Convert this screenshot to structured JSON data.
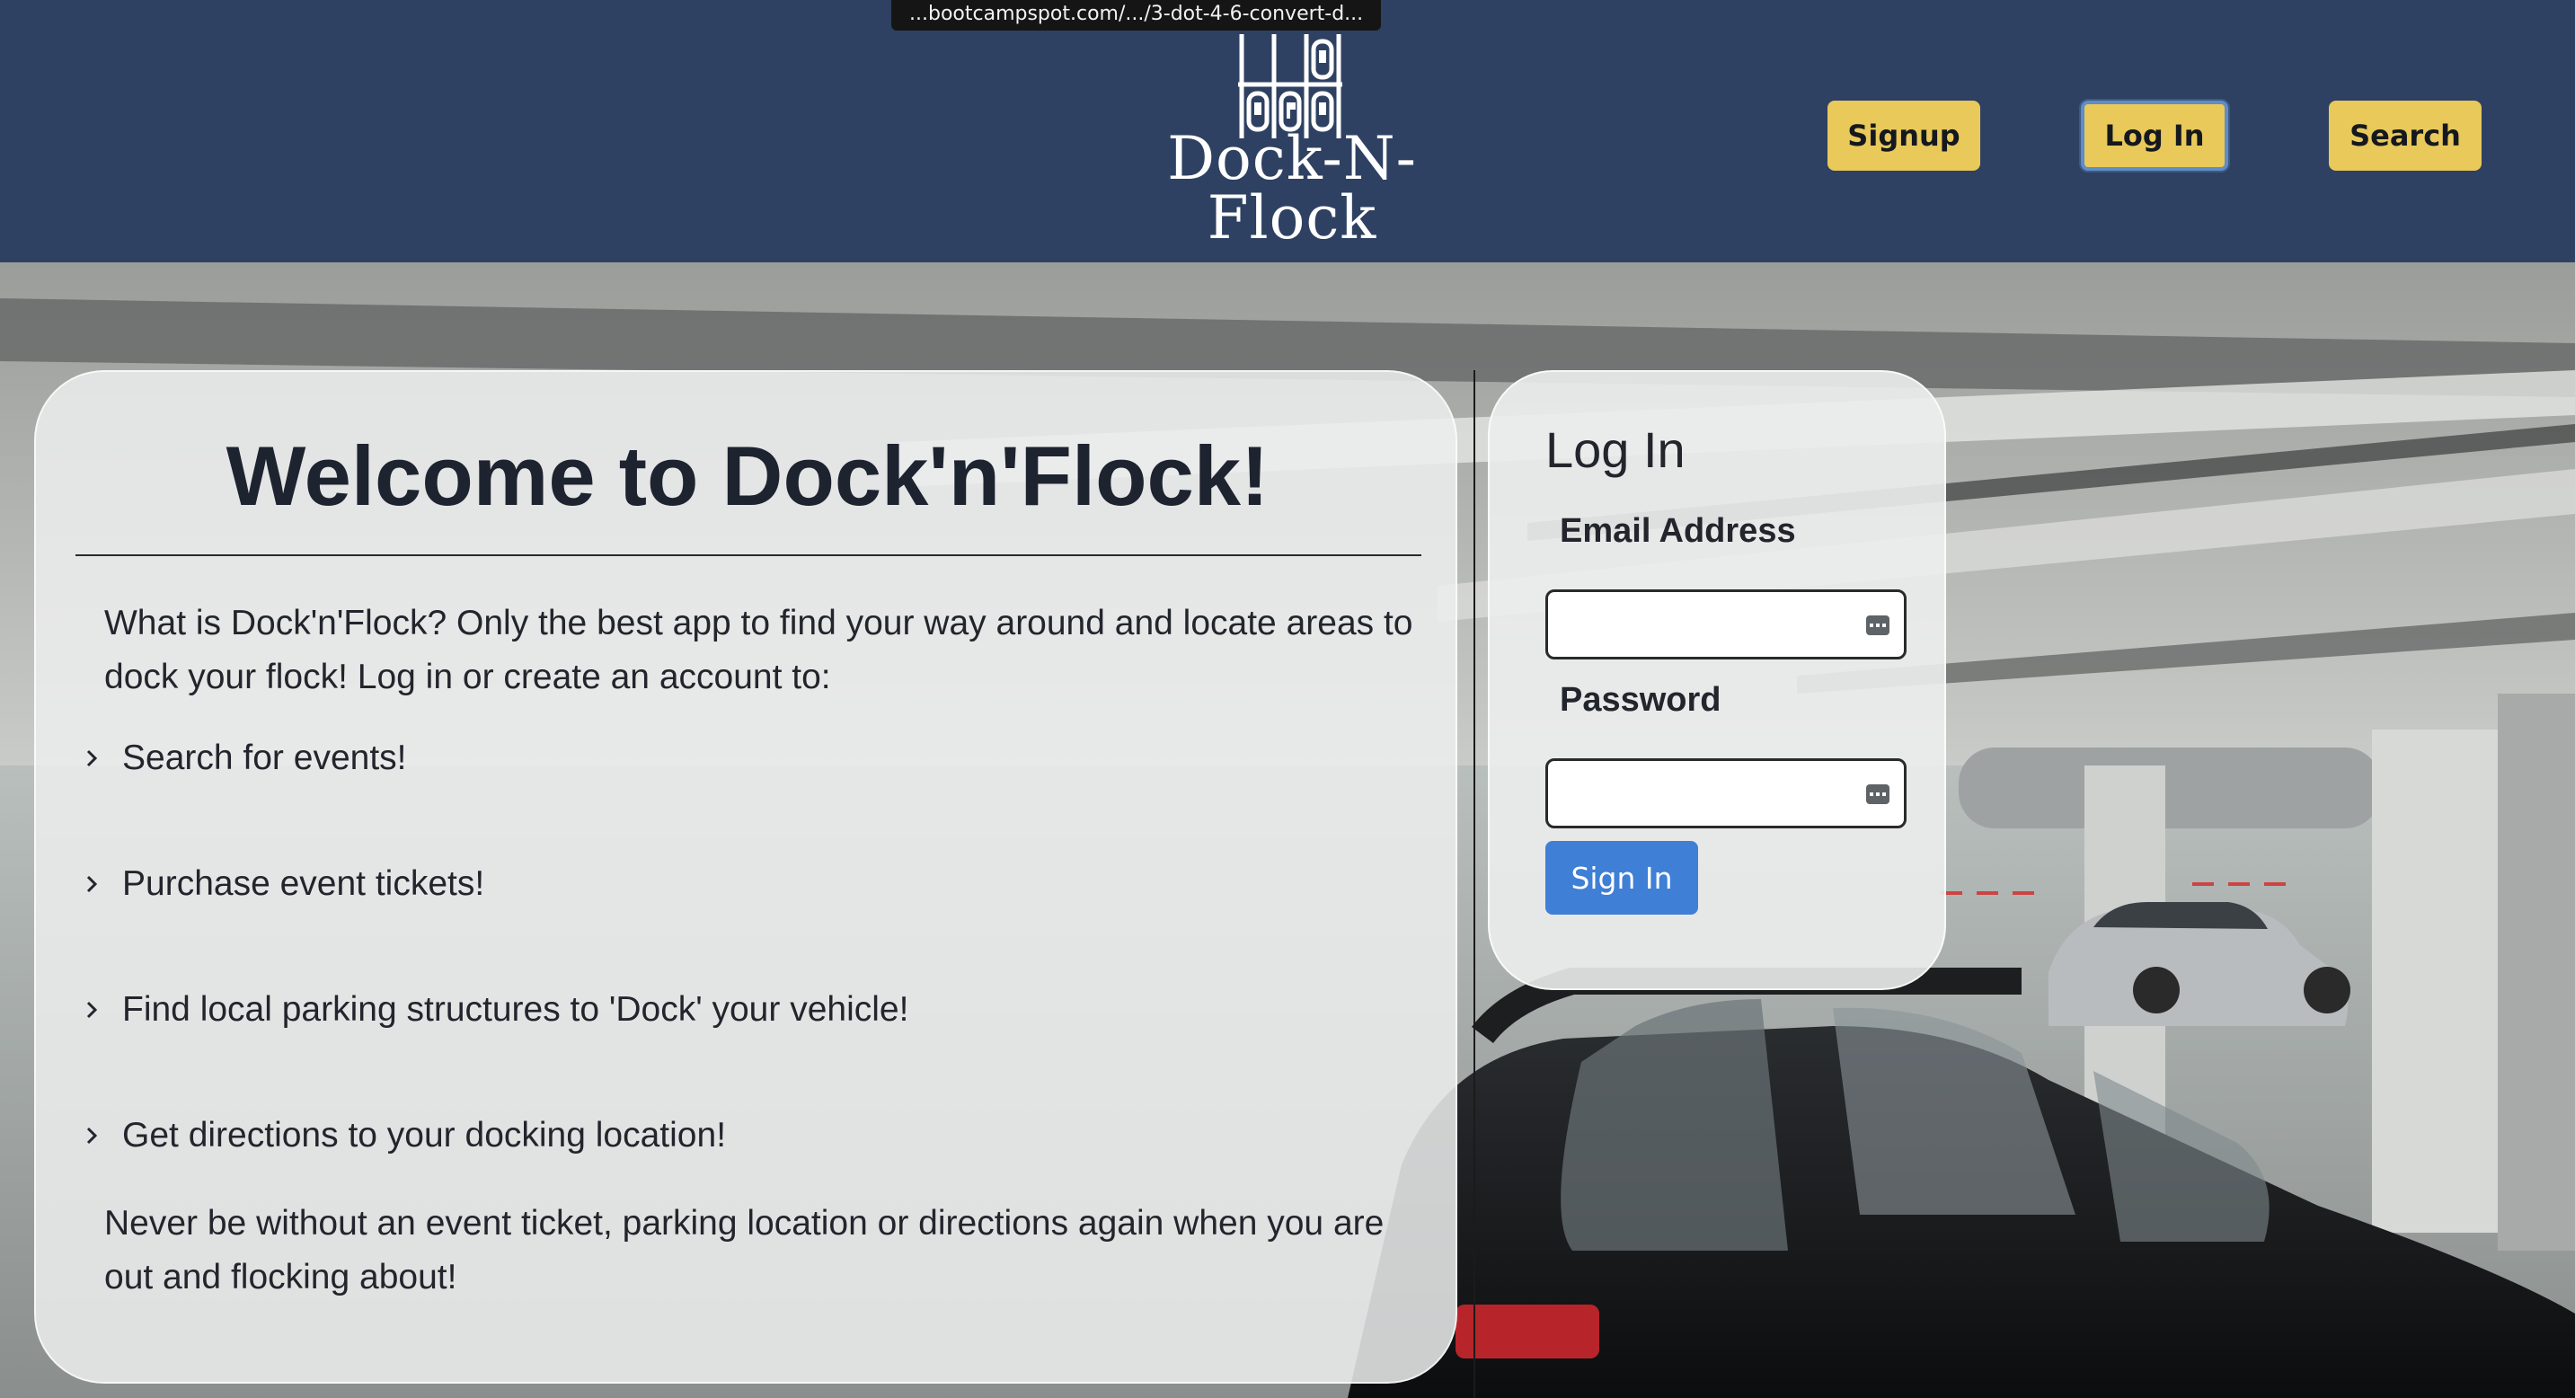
{
  "browser": {
    "url_tooltip": "...bootcampspot.com/.../3-dot-4-6-convert-d..."
  },
  "header": {
    "logo_text": "Dock-N-Flock",
    "nav": {
      "signup": "Signup",
      "login": "Log In",
      "search": "Search"
    }
  },
  "welcome": {
    "title": "Welcome to Dock'n'Flock!",
    "intro": "What is Dock'n'Flock? Only the best app to find your way around and locate areas to dock your flock! Log in or create an account to:",
    "features": [
      "Search for events!",
      "Purchase event tickets!",
      "Find local parking structures to 'Dock' your vehicle!",
      "Get directions to your docking location!"
    ],
    "outro": "Never be without an event ticket, parking location or directions again when you are out and flocking about!"
  },
  "login": {
    "title": "Log In",
    "email_label": "Email Address",
    "email_value": "",
    "password_label": "Password",
    "password_value": "",
    "submit": "Sign In"
  },
  "colors": {
    "header_bg": "#2f4162",
    "nav_button": "#e8c95a",
    "signin_button": "#3f7fd6"
  }
}
